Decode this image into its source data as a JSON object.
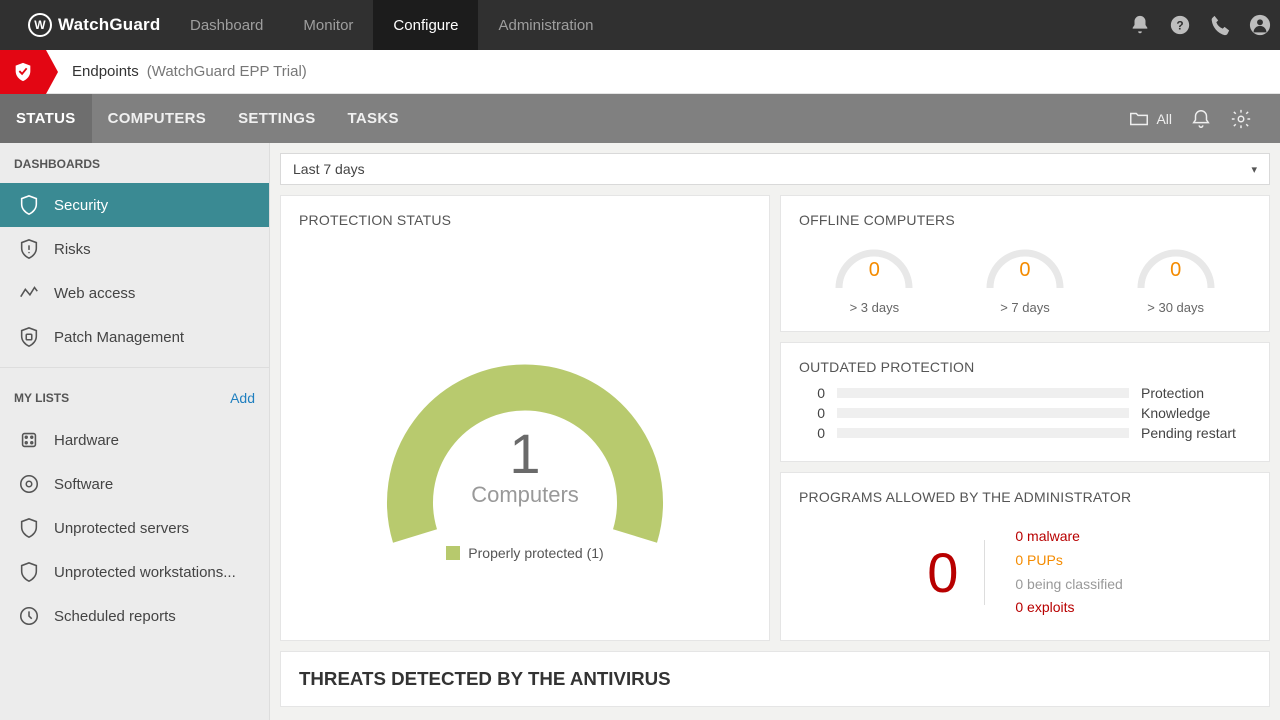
{
  "brand": "WatchGuard",
  "topnav": {
    "items": [
      "Dashboard",
      "Monitor",
      "Configure",
      "Administration"
    ],
    "activeIndex": 2
  },
  "breadcrumb": {
    "root": "Endpoints",
    "sub": "(WatchGuard EPP Trial)"
  },
  "subnav": {
    "items": [
      "STATUS",
      "COMPUTERS",
      "SETTINGS",
      "TASKS"
    ],
    "activeIndex": 0,
    "allLabel": "All"
  },
  "sidebar": {
    "dashboardsHeader": "DASHBOARDS",
    "dashboards": [
      "Security",
      "Risks",
      "Web access",
      "Patch Management"
    ],
    "dashboardsActive": 0,
    "myListsHeader": "MY LISTS",
    "addLabel": "Add",
    "lists": [
      "Hardware",
      "Software",
      "Unprotected servers",
      "Unprotected workstations...",
      "Scheduled reports"
    ]
  },
  "dateRange": "Last 7 days",
  "protectionStatus": {
    "title": "PROTECTION STATUS",
    "count": "1",
    "label": "Computers",
    "legend": "Properly protected (1)"
  },
  "offline": {
    "title": "OFFLINE COMPUTERS",
    "items": [
      {
        "value": "0",
        "caption": "> 3 days"
      },
      {
        "value": "0",
        "caption": "> 7 days"
      },
      {
        "value": "0",
        "caption": "> 30 days"
      }
    ]
  },
  "outdated": {
    "title": "OUTDATED PROTECTION",
    "rows": [
      {
        "count": "0",
        "label": "Protection"
      },
      {
        "count": "0",
        "label": "Knowledge"
      },
      {
        "count": "0",
        "label": "Pending restart"
      }
    ]
  },
  "programs": {
    "title": "PROGRAMS ALLOWED BY THE ADMINISTRATOR",
    "big": "0",
    "lines": [
      {
        "text": "0 malware",
        "cls": "c-red"
      },
      {
        "text": "0 PUPs",
        "cls": "c-orange"
      },
      {
        "text": "0 being classified",
        "cls": "c-gray"
      },
      {
        "text": "0 exploits",
        "cls": "c-red"
      }
    ]
  },
  "threats": {
    "title": "THREATS DETECTED BY THE ANTIVIRUS"
  }
}
